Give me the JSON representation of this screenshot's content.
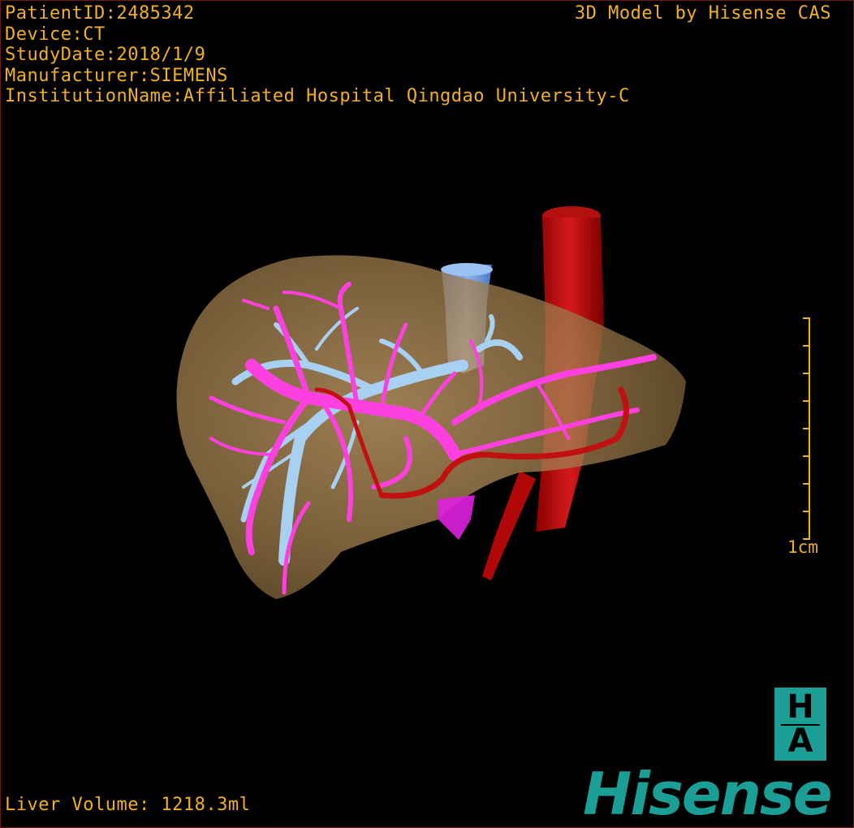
{
  "patient_info": {
    "patient_id": "PatientID:2485342",
    "device": "Device:CT",
    "study_date": "StudyDate:2018/1/9",
    "manufacturer": "Manufacturer:SIEMENS",
    "institution": "InstitutionName:Affiliated Hospital Qingdao University-C"
  },
  "credit": "3D Model by Hisense CAS",
  "liver_volume": "Liver Volume: 1218.3ml",
  "scale_bar": {
    "label": "1cm"
  },
  "logo": {
    "badge_top": "H",
    "badge_bottom": "A",
    "brand": "Hisense"
  },
  "colors": {
    "text": "#f0b020",
    "liver": "#a8844f",
    "portal_vein": "#ff40e0",
    "hepatic_vein": "#a8d0f0",
    "artery": "#c01010",
    "ivc": "#5b8fd8",
    "brand": "#1a9e96"
  }
}
